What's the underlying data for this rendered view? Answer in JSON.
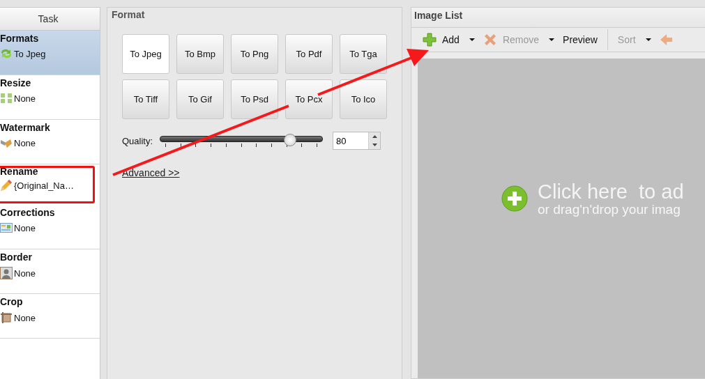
{
  "task_panel": {
    "header": "Task",
    "items": [
      {
        "title": "Formats",
        "value": "To Jpeg",
        "selected": true,
        "highlighted": false
      },
      {
        "title": "Resize",
        "value": "None",
        "selected": false,
        "highlighted": false
      },
      {
        "title": "Watermark",
        "value": "None",
        "selected": false,
        "highlighted": false
      },
      {
        "title": "Rename",
        "value": "{Original_Na…",
        "selected": false,
        "highlighted": true
      },
      {
        "title": "Corrections",
        "value": "None",
        "selected": false,
        "highlighted": false
      },
      {
        "title": "Border",
        "value": "None",
        "selected": false,
        "highlighted": false
      },
      {
        "title": "Crop",
        "value": "None",
        "selected": false,
        "highlighted": false
      }
    ]
  },
  "format_panel": {
    "title": "Format",
    "buttons": [
      {
        "label": "To Jpeg",
        "selected": true
      },
      {
        "label": "To Bmp",
        "selected": false
      },
      {
        "label": "To Png",
        "selected": false
      },
      {
        "label": "To Pdf",
        "selected": false
      },
      {
        "label": "To Tga",
        "selected": false
      },
      {
        "label": "To Tiff",
        "selected": false
      },
      {
        "label": "To Gif",
        "selected": false
      },
      {
        "label": "To Psd",
        "selected": false
      },
      {
        "label": "To Pcx",
        "selected": false
      },
      {
        "label": "To Ico",
        "selected": false
      }
    ],
    "quality": {
      "label": "Quality:",
      "level": 0.8,
      "value": "80"
    },
    "advanced_link": "Advanced >>"
  },
  "image_list": {
    "title": "Image List",
    "toolbar": [
      {
        "kind": "add",
        "label": "Add",
        "dropdown": true,
        "disabled": false
      },
      {
        "kind": "remove",
        "label": "Remove",
        "dropdown": true,
        "disabled": true
      },
      {
        "kind": "preview",
        "label": "Preview",
        "dropdown": false,
        "disabled": false
      },
      {
        "kind": "separator"
      },
      {
        "kind": "sort",
        "label": "Sort",
        "dropdown": true,
        "disabled": true
      },
      {
        "kind": "back",
        "disabled": true
      }
    ],
    "drop_hint": {
      "title": "Click here  to ad",
      "subtitle": "or drag'n'drop your imag"
    }
  },
  "annotations": [
    {
      "kind": "arrow"
    }
  ]
}
